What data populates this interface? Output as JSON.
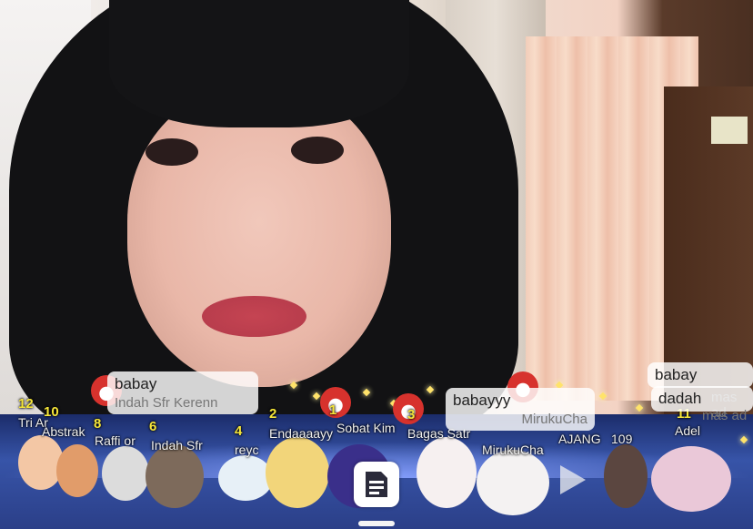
{
  "chat": {
    "bubbles": [
      {
        "message": "babay",
        "sender": "Indah Sfr Kerenn"
      },
      {
        "message": "babayyy",
        "sender": "MirukuCha"
      },
      {
        "message": "babay",
        "sender": ""
      },
      {
        "message": "dadah",
        "sender": ""
      }
    ],
    "faded_text": [
      "mas ad",
      "mas ad"
    ]
  },
  "viewers": [
    {
      "rank": "12",
      "name": "Tri Ar"
    },
    {
      "rank": "10",
      "name": "Abstrak"
    },
    {
      "rank": "8",
      "name": "Raffi or"
    },
    {
      "rank": "6",
      "name": "Indah Sfr"
    },
    {
      "rank": "4",
      "name": "reyc"
    },
    {
      "rank": "2",
      "name": "Endaaaayy"
    },
    {
      "rank": "1",
      "name": "Sobat Kim"
    },
    {
      "rank": "3",
      "name": "Bagas Satr"
    },
    {
      "rank": "",
      "name": "MirukuCha"
    },
    {
      "rank": "",
      "name": "AJANG"
    },
    {
      "rank": "",
      "name": "109"
    },
    {
      "rank": "11",
      "name": "Adel"
    }
  ],
  "controls": {
    "menu_icon": "document-list-icon",
    "play_icon": "play-icon"
  },
  "colors": {
    "rank": "#f6e63a",
    "stage": "#2b3f88"
  }
}
